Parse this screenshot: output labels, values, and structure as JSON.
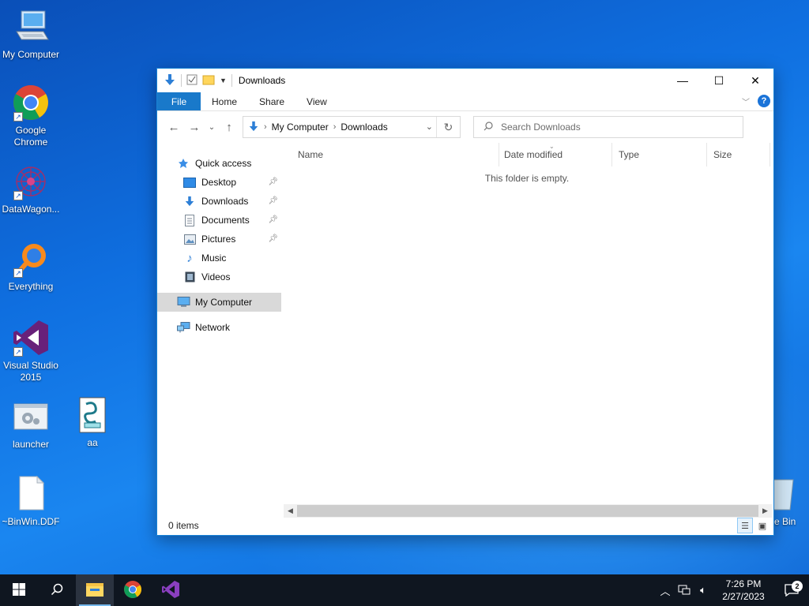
{
  "desktop": {
    "icons": [
      {
        "label": "My Computer"
      },
      {
        "label": "Google Chrome"
      },
      {
        "label": "DataWagon..."
      },
      {
        "label": "Everything"
      },
      {
        "label": "Visual Studio 2015"
      },
      {
        "label": "launcher"
      },
      {
        "label": "aa"
      },
      {
        "label": "~BinWin.DDF"
      },
      {
        "label": "e Bin"
      }
    ]
  },
  "window": {
    "title": "Downloads",
    "ribbon_tabs": [
      "File",
      "Home",
      "Share",
      "View"
    ],
    "address": {
      "crumbs": [
        "My Computer",
        "Downloads"
      ]
    },
    "search": {
      "placeholder": "Search Downloads"
    },
    "nav_pane": {
      "quick_access": "Quick access",
      "items": [
        {
          "label": "Desktop",
          "pinned": true
        },
        {
          "label": "Downloads",
          "pinned": true
        },
        {
          "label": "Documents",
          "pinned": true
        },
        {
          "label": "Pictures",
          "pinned": true
        },
        {
          "label": "Music",
          "pinned": false
        },
        {
          "label": "Videos",
          "pinned": false
        }
      ],
      "my_computer": "My Computer",
      "network": "Network"
    },
    "columns": [
      "Name",
      "Date modified",
      "Type",
      "Size"
    ],
    "empty_message": "This folder is empty.",
    "status": "0 items"
  },
  "taskbar": {
    "clock_time": "7:26 PM",
    "clock_date": "2/27/2023",
    "notification_count": "2"
  },
  "colors": {
    "accent": "#1979ca",
    "taskbar": "#0f1620"
  }
}
